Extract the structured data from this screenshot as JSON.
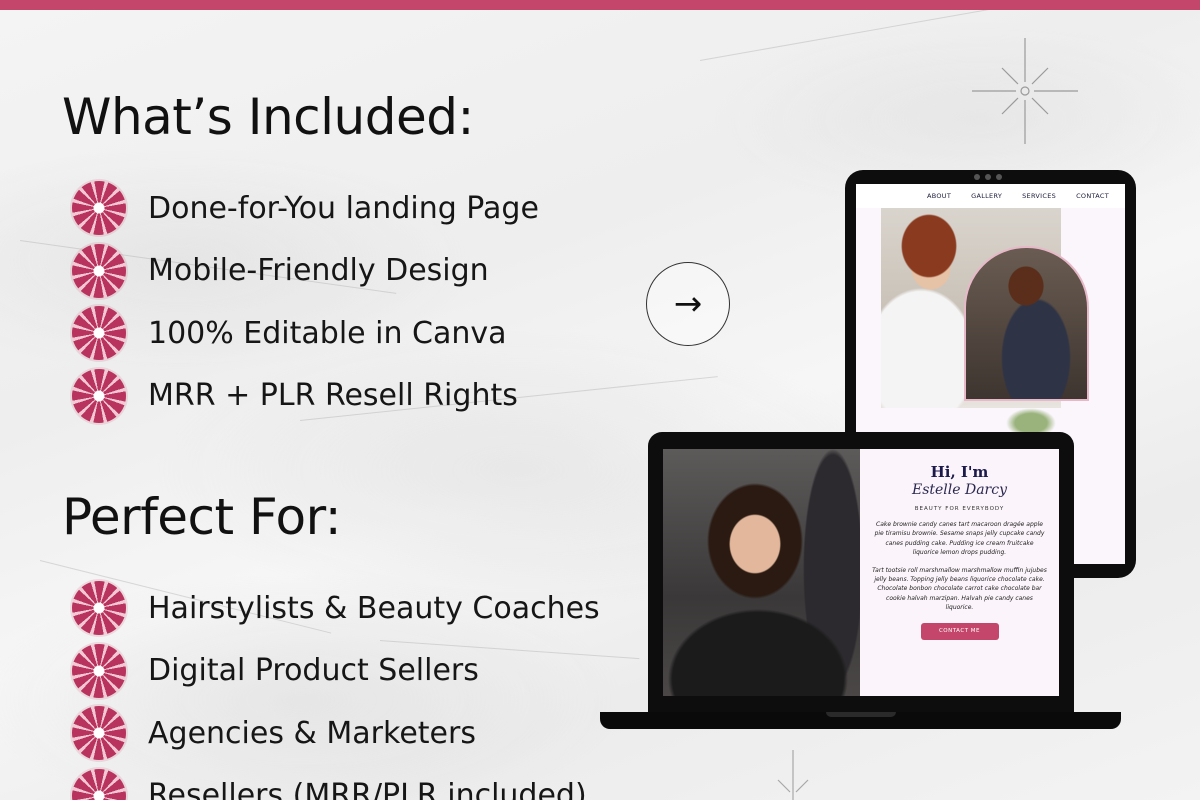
{
  "sections": [
    {
      "heading": "What’s Included:",
      "items": [
        "Done-for-You landing Page",
        "Mobile-Friendly Design",
        "100% Editable in Canva",
        "MRR + PLR Resell Rights"
      ]
    },
    {
      "heading": "Perfect For:",
      "items": [
        "Hairstylists & Beauty Coaches",
        "Digital Product Sellers",
        "Agencies & Marketers",
        "Resellers (MRR/PLR included)"
      ]
    }
  ],
  "icons": {
    "bullet": "swirl-icon",
    "arrow": "arrow-right-icon",
    "sparkle": "sparkle-icon"
  },
  "colors": {
    "accent": "#c4476b",
    "device": "#0d0d0d",
    "heading_navy": "#1c1a4a"
  },
  "tablet": {
    "nav": [
      "ABOUT",
      "GALLERY",
      "SERVICES",
      "CONTACT"
    ]
  },
  "laptop": {
    "greeting": "Hi, I'm",
    "name": "Estelle Darcy",
    "tagline": "BEAUTY FOR EVERYBODY",
    "paragraph1": "Cake brownie candy canes tart macaroon dragée apple pie tiramisu brownie. Sesame snaps jelly cupcake candy canes pudding cake. Pudding ice cream fruitcake liquorice lemon drops pudding.",
    "paragraph2": "Tart tootsie roll marshmallow marshmallow muffin jujubes jelly beans. Topping jelly beans liquorice chocolate cake. Chocolate bonbon chocolate carrot cake chocolate bar cookie halvah marzipan. Halvah pie candy canes liquorice.",
    "button": "CONTACT ME"
  }
}
